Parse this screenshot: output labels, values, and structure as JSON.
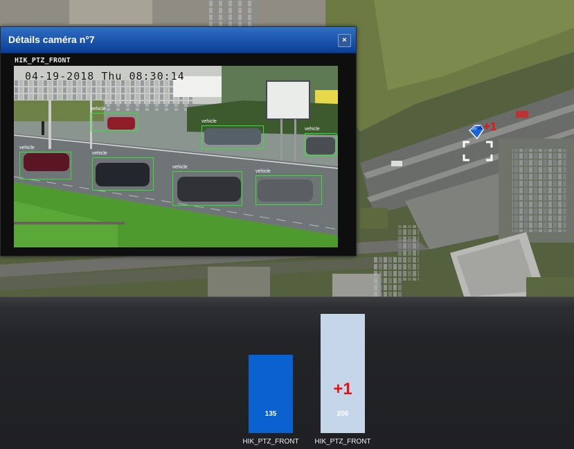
{
  "popup": {
    "title": "Détails caméra n°7",
    "close_label": "×",
    "camera_name": "HIK_PTZ_FRONT",
    "osd_text": "04-19-2018 Thu 08:30:14",
    "detection_label": "vehicle",
    "detection_color": "#2ee62e",
    "title_bar_color": "#0b3e96"
  },
  "map": {
    "marker_increment": "+1",
    "marker_icon": "camera-gem-icon",
    "focus_icon": "focus-brackets-icon"
  },
  "chart_data": {
    "type": "bar",
    "categories": [
      "HIK_PTZ_FRONT",
      "HIK_PTZ_FRONT"
    ],
    "values": [
      135,
      206
    ],
    "value_labels": [
      "135",
      "206"
    ],
    "increment_label": "+1",
    "colors": [
      "#0a62d0",
      "#c6d6ea"
    ],
    "ylim": [
      0,
      206
    ]
  }
}
